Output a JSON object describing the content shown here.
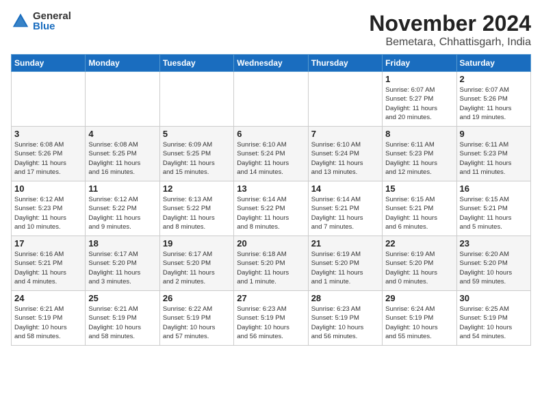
{
  "header": {
    "logo_general": "General",
    "logo_blue": "Blue",
    "month": "November 2024",
    "location": "Bemetara, Chhattisgarh, India"
  },
  "weekdays": [
    "Sunday",
    "Monday",
    "Tuesday",
    "Wednesday",
    "Thursday",
    "Friday",
    "Saturday"
  ],
  "weeks": [
    [
      {
        "day": "",
        "info": ""
      },
      {
        "day": "",
        "info": ""
      },
      {
        "day": "",
        "info": ""
      },
      {
        "day": "",
        "info": ""
      },
      {
        "day": "",
        "info": ""
      },
      {
        "day": "1",
        "info": "Sunrise: 6:07 AM\nSunset: 5:27 PM\nDaylight: 11 hours\nand 20 minutes."
      },
      {
        "day": "2",
        "info": "Sunrise: 6:07 AM\nSunset: 5:26 PM\nDaylight: 11 hours\nand 19 minutes."
      }
    ],
    [
      {
        "day": "3",
        "info": "Sunrise: 6:08 AM\nSunset: 5:26 PM\nDaylight: 11 hours\nand 17 minutes."
      },
      {
        "day": "4",
        "info": "Sunrise: 6:08 AM\nSunset: 5:25 PM\nDaylight: 11 hours\nand 16 minutes."
      },
      {
        "day": "5",
        "info": "Sunrise: 6:09 AM\nSunset: 5:25 PM\nDaylight: 11 hours\nand 15 minutes."
      },
      {
        "day": "6",
        "info": "Sunrise: 6:10 AM\nSunset: 5:24 PM\nDaylight: 11 hours\nand 14 minutes."
      },
      {
        "day": "7",
        "info": "Sunrise: 6:10 AM\nSunset: 5:24 PM\nDaylight: 11 hours\nand 13 minutes."
      },
      {
        "day": "8",
        "info": "Sunrise: 6:11 AM\nSunset: 5:23 PM\nDaylight: 11 hours\nand 12 minutes."
      },
      {
        "day": "9",
        "info": "Sunrise: 6:11 AM\nSunset: 5:23 PM\nDaylight: 11 hours\nand 11 minutes."
      }
    ],
    [
      {
        "day": "10",
        "info": "Sunrise: 6:12 AM\nSunset: 5:23 PM\nDaylight: 11 hours\nand 10 minutes."
      },
      {
        "day": "11",
        "info": "Sunrise: 6:12 AM\nSunset: 5:22 PM\nDaylight: 11 hours\nand 9 minutes."
      },
      {
        "day": "12",
        "info": "Sunrise: 6:13 AM\nSunset: 5:22 PM\nDaylight: 11 hours\nand 8 minutes."
      },
      {
        "day": "13",
        "info": "Sunrise: 6:14 AM\nSunset: 5:22 PM\nDaylight: 11 hours\nand 8 minutes."
      },
      {
        "day": "14",
        "info": "Sunrise: 6:14 AM\nSunset: 5:21 PM\nDaylight: 11 hours\nand 7 minutes."
      },
      {
        "day": "15",
        "info": "Sunrise: 6:15 AM\nSunset: 5:21 PM\nDaylight: 11 hours\nand 6 minutes."
      },
      {
        "day": "16",
        "info": "Sunrise: 6:15 AM\nSunset: 5:21 PM\nDaylight: 11 hours\nand 5 minutes."
      }
    ],
    [
      {
        "day": "17",
        "info": "Sunrise: 6:16 AM\nSunset: 5:21 PM\nDaylight: 11 hours\nand 4 minutes."
      },
      {
        "day": "18",
        "info": "Sunrise: 6:17 AM\nSunset: 5:20 PM\nDaylight: 11 hours\nand 3 minutes."
      },
      {
        "day": "19",
        "info": "Sunrise: 6:17 AM\nSunset: 5:20 PM\nDaylight: 11 hours\nand 2 minutes."
      },
      {
        "day": "20",
        "info": "Sunrise: 6:18 AM\nSunset: 5:20 PM\nDaylight: 11 hours\nand 1 minute."
      },
      {
        "day": "21",
        "info": "Sunrise: 6:19 AM\nSunset: 5:20 PM\nDaylight: 11 hours\nand 1 minute."
      },
      {
        "day": "22",
        "info": "Sunrise: 6:19 AM\nSunset: 5:20 PM\nDaylight: 11 hours\nand 0 minutes."
      },
      {
        "day": "23",
        "info": "Sunrise: 6:20 AM\nSunset: 5:20 PM\nDaylight: 10 hours\nand 59 minutes."
      }
    ],
    [
      {
        "day": "24",
        "info": "Sunrise: 6:21 AM\nSunset: 5:19 PM\nDaylight: 10 hours\nand 58 minutes."
      },
      {
        "day": "25",
        "info": "Sunrise: 6:21 AM\nSunset: 5:19 PM\nDaylight: 10 hours\nand 58 minutes."
      },
      {
        "day": "26",
        "info": "Sunrise: 6:22 AM\nSunset: 5:19 PM\nDaylight: 10 hours\nand 57 minutes."
      },
      {
        "day": "27",
        "info": "Sunrise: 6:23 AM\nSunset: 5:19 PM\nDaylight: 10 hours\nand 56 minutes."
      },
      {
        "day": "28",
        "info": "Sunrise: 6:23 AM\nSunset: 5:19 PM\nDaylight: 10 hours\nand 56 minutes."
      },
      {
        "day": "29",
        "info": "Sunrise: 6:24 AM\nSunset: 5:19 PM\nDaylight: 10 hours\nand 55 minutes."
      },
      {
        "day": "30",
        "info": "Sunrise: 6:25 AM\nSunset: 5:19 PM\nDaylight: 10 hours\nand 54 minutes."
      }
    ]
  ]
}
